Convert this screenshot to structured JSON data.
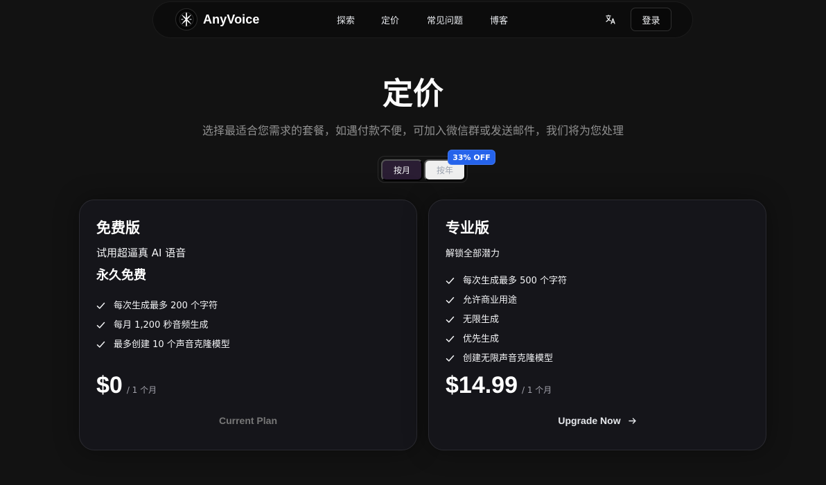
{
  "header": {
    "brand_name": "AnyVoice",
    "nav": [
      "探索",
      "定价",
      "常见问题",
      "博客"
    ],
    "translate_icon": "translate-icon",
    "login_label": "登录"
  },
  "page": {
    "title": "定价",
    "subtitle": "选择最适合您需求的套餐，如遇付款不便，可加入微信群或发送邮件，我们将为您处理"
  },
  "billing": {
    "options": [
      "按月",
      "按年"
    ],
    "selected": "按月",
    "discount": "33% OFF"
  },
  "plans": [
    {
      "name": "免费版",
      "description": "试用超逼真 AI 语音",
      "note": "永久免费",
      "features": [
        "每次生成最多 200 个字符",
        "每月 1,200 秒音频生成",
        "最多创建 10 个声音克隆模型"
      ],
      "price": "$0",
      "period": "/ 1 个月",
      "action": "Current Plan"
    },
    {
      "name": "专业版",
      "description": "解锁全部潜力",
      "features": [
        "每次生成最多 500 个字符",
        "允许商业用途",
        "无限生成",
        "优先生成",
        "创建无限声音克隆模型"
      ],
      "price": "$14.99",
      "period": "/ 1 个月",
      "action": "Upgrade Now",
      "action_icon": "arrow-right-icon"
    }
  ],
  "colors": {
    "background": "#121212",
    "card": "#15151a",
    "discount": "#2563eb",
    "selected_toggle": "#2a1d33"
  }
}
